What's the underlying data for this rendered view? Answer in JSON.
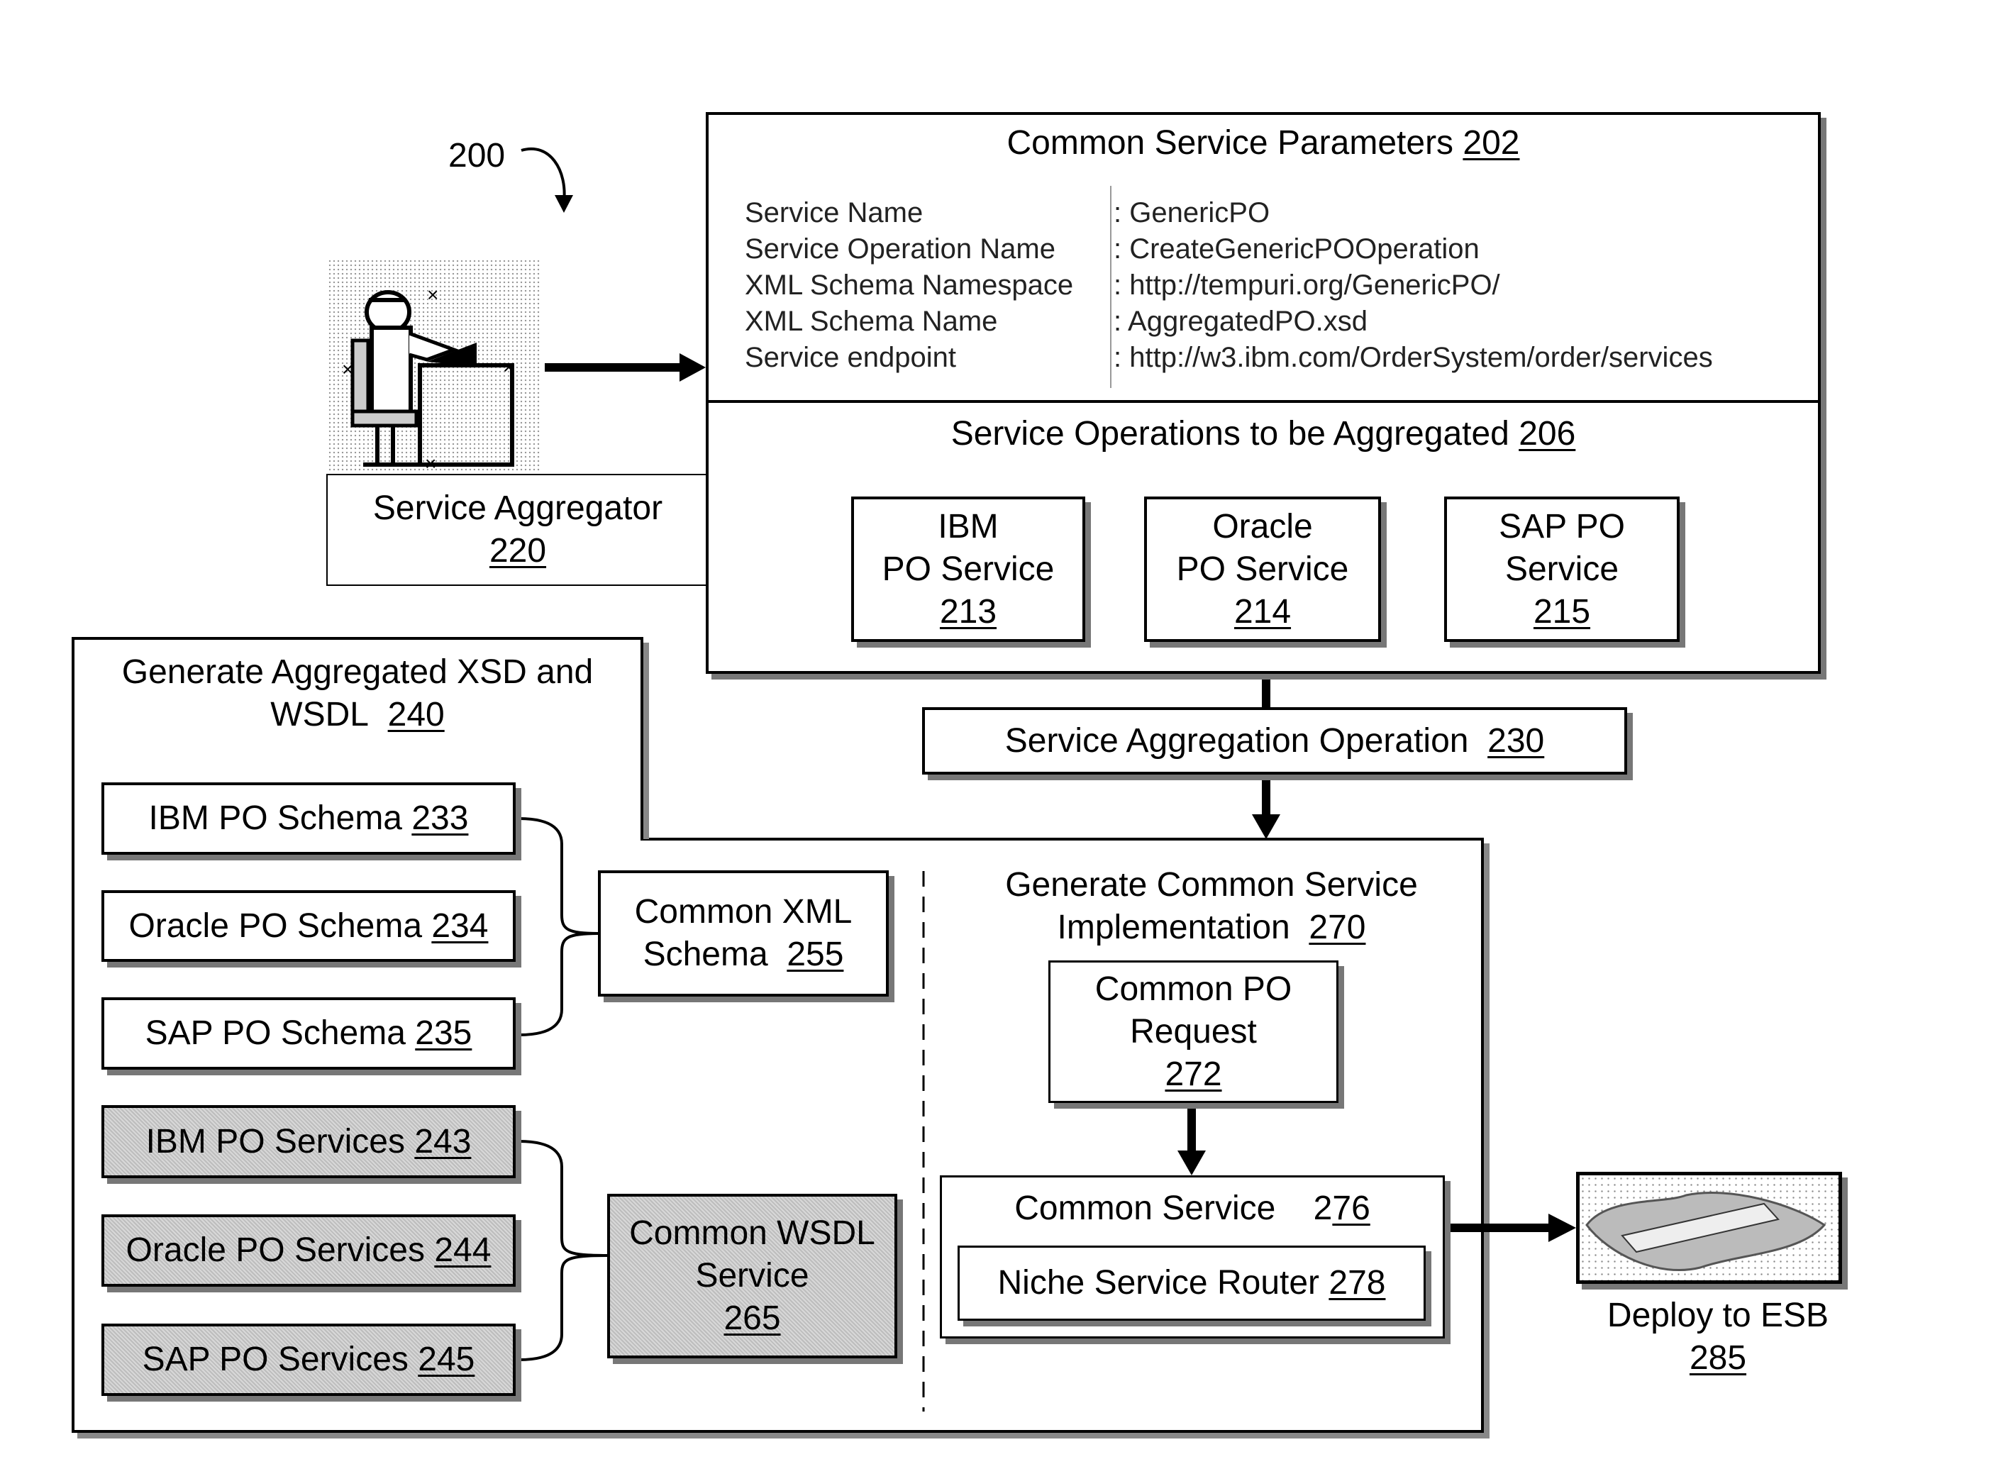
{
  "figure": {
    "ref_number": "200"
  },
  "service_aggregator": {
    "label": "Service Aggregator",
    "ref": "220",
    "icon": "person-at-desk-icon"
  },
  "common_params": {
    "title": "Common Service Parameters",
    "ref": "202",
    "rows": [
      {
        "key": "Service Name",
        "value": ": GenericPO"
      },
      {
        "key": "Service Operation Name",
        "value": ": CreateGenericPOOperation"
      },
      {
        "key": "XML Schema Namespace",
        "value": ": http://tempuri.org/GenericPO/"
      },
      {
        "key": "XML Schema Name",
        "value": ": AggregatedPO.xsd"
      },
      {
        "key": "Service endpoint",
        "value": ": http://w3.ibm.com/OrderSystem/order/services"
      }
    ]
  },
  "service_ops": {
    "title": "Service Operations to be Aggregated",
    "ref": "206",
    "items": [
      {
        "line1": "IBM",
        "line2": "PO Service",
        "ref": "213"
      },
      {
        "line1": "Oracle",
        "line2": "PO Service",
        "ref": "214"
      },
      {
        "line1": "SAP PO",
        "line2": "Service",
        "ref": "215"
      }
    ]
  },
  "aggregation_op": {
    "label": "Service Aggregation Operation",
    "ref": "230"
  },
  "generate_xsd": {
    "title_line1": "Generate Aggregated  XSD and",
    "title_line2": "WSDL",
    "ref": "240",
    "schemas": [
      {
        "label": "IBM PO Schema",
        "ref": "233"
      },
      {
        "label": "Oracle PO Schema",
        "ref": "234"
      },
      {
        "label": "SAP PO Schema",
        "ref": "235"
      }
    ],
    "common_schema": {
      "line1": "Common XML",
      "line2": "Schema",
      "ref": "255"
    },
    "services": [
      {
        "label": "IBM PO Services",
        "ref": "243"
      },
      {
        "label": "Oracle PO Services",
        "ref": "244"
      },
      {
        "label": "SAP PO Services",
        "ref": "245"
      }
    ],
    "common_wsdl": {
      "line1": "Common WSDL",
      "line2": "Service",
      "ref": "265"
    }
  },
  "generate_impl": {
    "title_line1": "Generate Common Service",
    "title_line2": "Implementation",
    "ref": "270",
    "po_request": {
      "line1": "Common PO",
      "line2": "Request",
      "ref": "272"
    },
    "common_service": {
      "label": "Common Service",
      "ref_prefix": "2",
      "ref": "76"
    },
    "router": {
      "label": "Niche Service Router",
      "ref": "278"
    }
  },
  "esb": {
    "label": "Deploy to ESB",
    "ref": "285",
    "icon": "esb-bus-icon"
  }
}
